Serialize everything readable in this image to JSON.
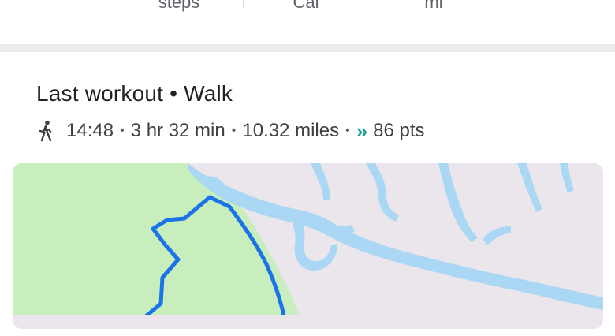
{
  "summary_stats": {
    "units": [
      "steps",
      "Cal",
      "mi"
    ]
  },
  "last_workout": {
    "title": "Last workout • Walk",
    "activity_icon": "walk-icon",
    "time": "14:48",
    "duration": "3 hr 32 min",
    "distance": "10.32 miles",
    "points_icon": "heart-points-icon",
    "points": "86 pts"
  },
  "map": {
    "route_color": "#1a73e8",
    "park_color": "#c8eebd",
    "water_color": "#aad7f3",
    "land_color": "#ebe6ec"
  }
}
